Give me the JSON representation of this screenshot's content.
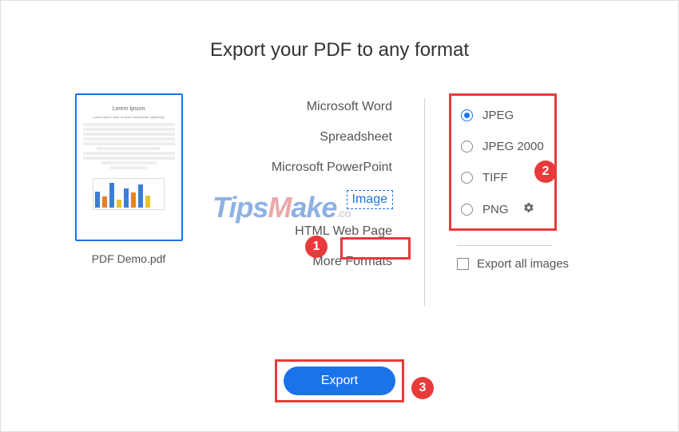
{
  "title": "Export your PDF to any format",
  "preview": {
    "doc_title": "Lorem Ipsum",
    "filename": "PDF Demo.pdf"
  },
  "formats": [
    {
      "label": "Microsoft Word",
      "selected": false
    },
    {
      "label": "Spreadsheet",
      "selected": false
    },
    {
      "label": "Microsoft PowerPoint",
      "selected": false
    },
    {
      "label": "Image",
      "selected": true
    },
    {
      "label": "HTML Web Page",
      "selected": false
    },
    {
      "label": "More Formats",
      "selected": false
    }
  ],
  "subformats": [
    {
      "label": "JPEG",
      "selected": true,
      "gear": false
    },
    {
      "label": "JPEG 2000",
      "selected": false,
      "gear": false
    },
    {
      "label": "TIFF",
      "selected": false,
      "gear": false
    },
    {
      "label": "PNG",
      "selected": false,
      "gear": true
    }
  ],
  "export_all_label": "Export all images",
  "export_button": "Export",
  "callouts": {
    "one": "1",
    "two": "2",
    "three": "3"
  },
  "watermark": "TipsMake",
  "watermark_suffix": ".co",
  "colors": {
    "accent": "#1a73e8",
    "highlight": "#e83a3a"
  }
}
